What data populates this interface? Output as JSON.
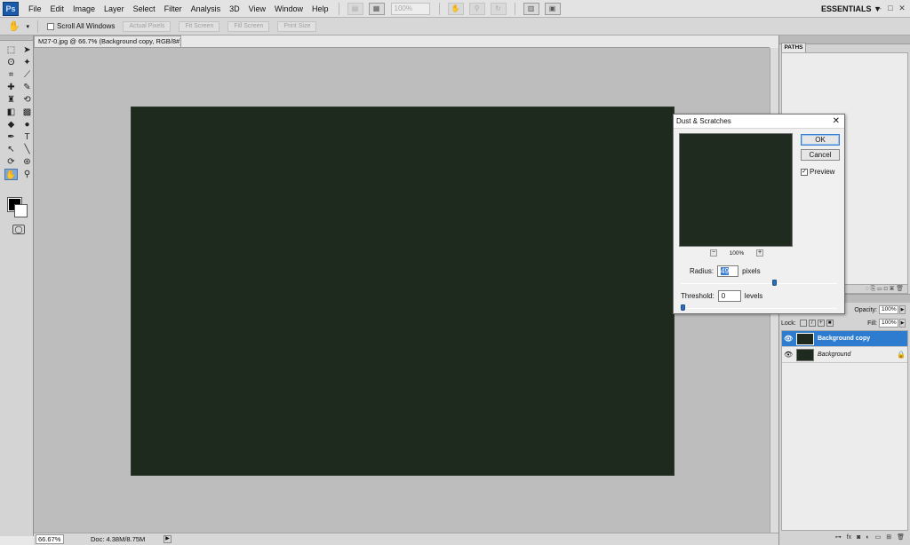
{
  "app": {
    "logo": "Ps",
    "menu": [
      "File",
      "Edit",
      "Image",
      "Layer",
      "Select",
      "Filter",
      "Analysis",
      "3D",
      "View",
      "Window",
      "Help"
    ],
    "zoom_field": "100%",
    "workspace": "ESSENTIALS ▼",
    "window_controls": [
      "–",
      "□",
      "✕"
    ]
  },
  "options_bar": {
    "scroll_all_windows": "Scroll All Windows",
    "buttons": [
      "Actual Pixels",
      "Fit Screen",
      "Fill Screen",
      "Print Size"
    ]
  },
  "document": {
    "tab_title": "M27-0.jpg @ 66.7% (Background copy, RGB/8#) *",
    "status_zoom": "66.67%",
    "status_doc": "Doc: 4.38M/8.75M",
    "image_color": "#1f2a1f"
  },
  "dialog": {
    "title": "Dust & Scratches",
    "close": "✕",
    "ok": "OK",
    "cancel": "Cancel",
    "preview_label": "Preview",
    "preview_checked": true,
    "preview_zoom": "100%",
    "radius_label": "Radius:",
    "radius_value": "49",
    "radius_unit": "pixels",
    "radius_level": 0.6,
    "threshold_label": "Threshold:",
    "threshold_value": "0",
    "threshold_unit": "levels",
    "threshold_level": 0.0
  },
  "panels": {
    "paths_tab": "PATHS",
    "opacity_label": "Opacity:",
    "opacity_value": "100%",
    "lock_label": "Lock:",
    "fill_label": "Fill:",
    "fill_value": "100%",
    "layers": [
      {
        "name": "Background copy",
        "selected": true,
        "locked": false
      },
      {
        "name": "Background",
        "selected": false,
        "locked": true
      }
    ],
    "footer_icons": [
      "link-icon",
      "fx-icon",
      "mask-icon",
      "adjustment-icon",
      "group-icon",
      "new-layer-icon",
      "trash-icon"
    ]
  },
  "colors": {
    "accent": "#2d7ccf",
    "canvas_bg": "#bdbdbd",
    "image": "#1f2a1f"
  }
}
